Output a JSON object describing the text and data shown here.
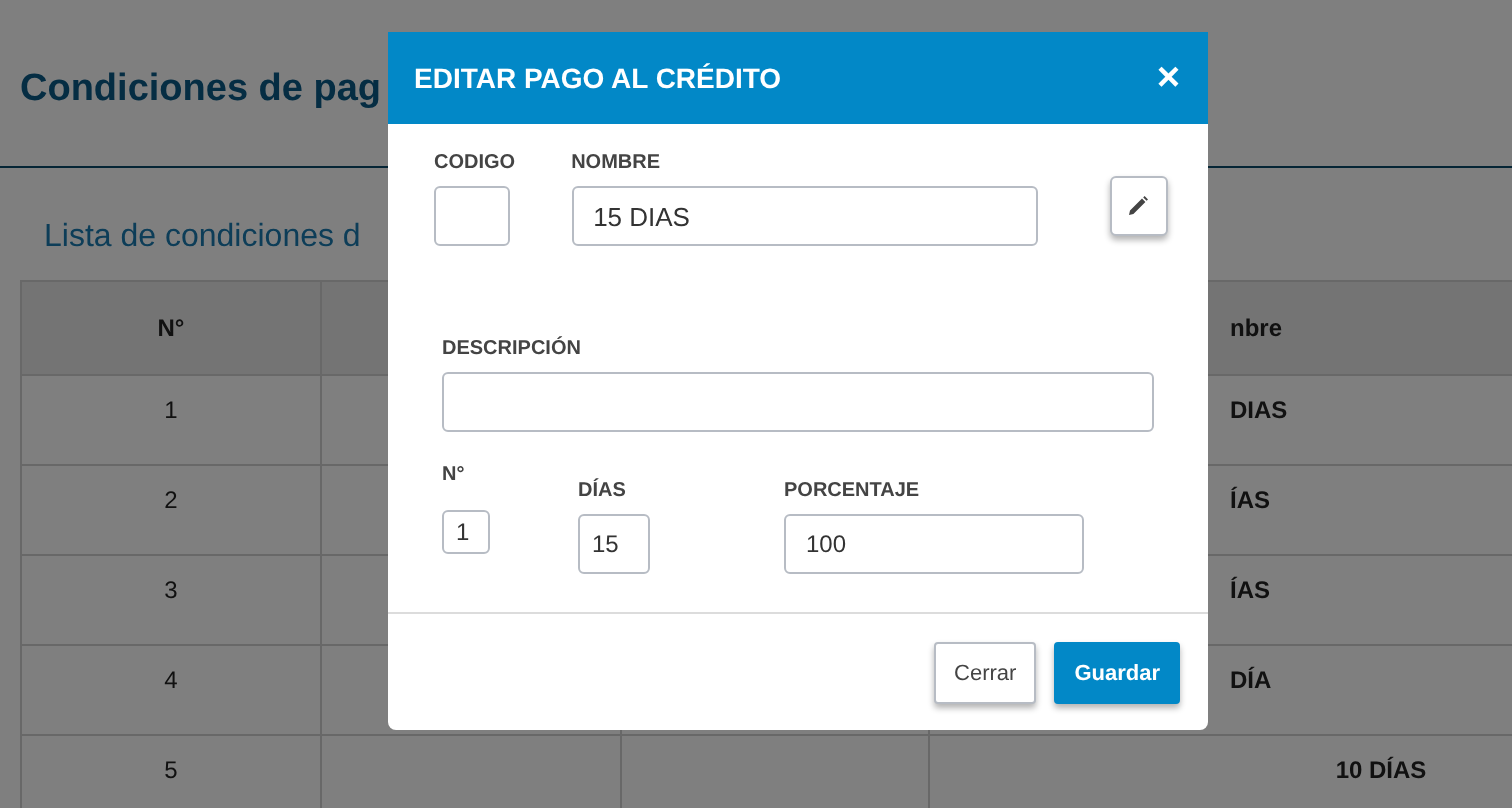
{
  "page": {
    "title": "Condiciones de pag",
    "subtitle": "Lista de condiciones d"
  },
  "table": {
    "columns": [
      "N°",
      "nbre"
    ],
    "rows": [
      {
        "number": "1",
        "name": "DIAS"
      },
      {
        "number": "2",
        "name": "ÍAS"
      },
      {
        "number": "3",
        "name": "ÍAS"
      },
      {
        "number": "4",
        "name": "DÍA"
      },
      {
        "number": "5",
        "name": "10 DÍAS"
      }
    ]
  },
  "modal": {
    "title": "EDITAR PAGO AL CRÉDITO",
    "close": "×",
    "codigo": {
      "label": "CODIGO"
    },
    "nombre": {
      "label": "NOMBRE",
      "value": "15 DIAS"
    },
    "descripcion": {
      "label": "DESCRIPCIÓN"
    },
    "numero": {
      "label": "N°",
      "value": "1"
    },
    "dias": {
      "label": "DÍAS",
      "value": "15"
    },
    "porcentaje": {
      "label": "PORCENTAJE",
      "value": "100"
    },
    "buttons": [
      {
        "label": "Cerrar",
        "kind": "secondary"
      },
      {
        "label": "Guardar",
        "kind": "primary"
      }
    ]
  }
}
